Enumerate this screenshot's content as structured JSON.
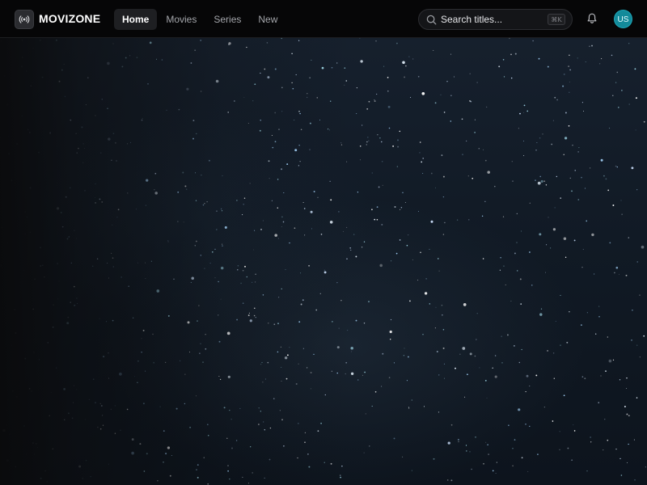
{
  "brand": {
    "name": "MOVIZONE",
    "logo_icon": "broadcast-icon"
  },
  "nav": {
    "items": [
      {
        "label": "Home",
        "active": true
      },
      {
        "label": "Movies",
        "active": false
      },
      {
        "label": "Series",
        "active": false
      },
      {
        "label": "New",
        "active": false
      }
    ]
  },
  "search": {
    "placeholder": "Search titles...",
    "value": "",
    "shortcut": "⌘K",
    "icon": "search-icon"
  },
  "actions": {
    "notifications_icon": "bell-icon",
    "avatar_initials": "US"
  },
  "hero": {
    "image": "starfield-night-sky"
  },
  "colors": {
    "accent": "#138a9a",
    "header_bg": "#060607",
    "hero_bg": "#111a25"
  }
}
